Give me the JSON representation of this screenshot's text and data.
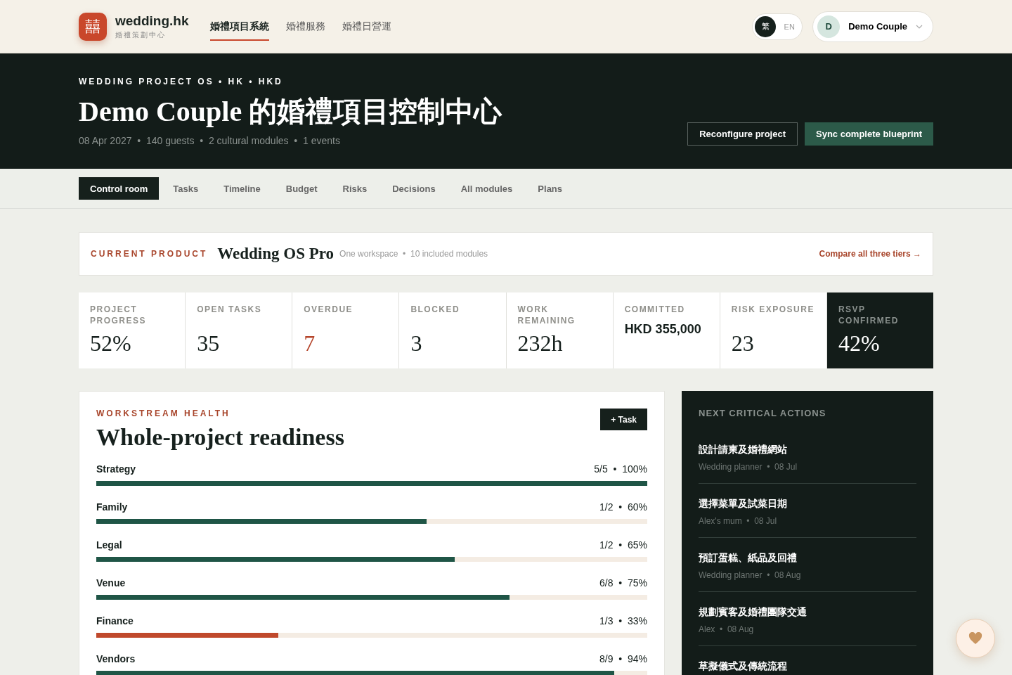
{
  "brand": {
    "logo": "囍",
    "name": "wedding.hk",
    "tagline": "婚禮策劃中心"
  },
  "nav": [
    {
      "label": "婚禮項目系統",
      "selected": true
    },
    {
      "label": "婚禮服務",
      "selected": false
    },
    {
      "label": "婚禮日營運",
      "selected": false
    }
  ],
  "language": [
    {
      "label": "繁",
      "selected": true
    },
    {
      "label": "EN",
      "selected": false
    }
  ],
  "user": {
    "initial": "D",
    "name": "Demo Couple"
  },
  "hero": {
    "eyebrow": "WEDDING PROJECT OS • HK • HKD",
    "title": "Demo Couple 的婚禮項目控制中心",
    "meta": "08 Apr 2027  •  140 guests  •  2 cultural modules  •  1 events",
    "buttons": [
      {
        "label": "Reconfigure project",
        "kind": "outline"
      },
      {
        "label": "Sync complete blueprint",
        "kind": "primary"
      }
    ]
  },
  "tabs": [
    {
      "label": "Control room",
      "selected": true
    },
    {
      "label": "Tasks",
      "selected": false
    },
    {
      "label": "Timeline",
      "selected": false
    },
    {
      "label": "Budget",
      "selected": false
    },
    {
      "label": "Risks",
      "selected": false
    },
    {
      "label": "Decisions",
      "selected": false
    },
    {
      "label": "All modules",
      "selected": false
    },
    {
      "label": "Plans",
      "selected": false
    }
  ],
  "product": {
    "label": "CURRENT PRODUCT",
    "name": "Wedding OS Pro",
    "detail": "One workspace  •  10 included modules",
    "link": "Compare all three tiers →"
  },
  "stats": [
    {
      "label": "PROJECT PROGRESS",
      "value": "52%",
      "kind": "plain"
    },
    {
      "label": "OPEN TASKS",
      "value": "35",
      "kind": "plain"
    },
    {
      "label": "OVERDUE",
      "value": "7",
      "kind": "alert"
    },
    {
      "label": "BLOCKED",
      "value": "3",
      "kind": "plain"
    },
    {
      "label": "WORK REMAINING",
      "value": "232h",
      "kind": "plain"
    },
    {
      "label": "COMMITTED",
      "value": "HKD 355,000",
      "kind": "amount"
    },
    {
      "label": "RISK EXPOSURE",
      "value": "23",
      "kind": "plain"
    },
    {
      "label": "RSVP CONFIRMED",
      "value": "42%",
      "kind": "dark"
    }
  ],
  "workstream": {
    "eyebrow": "WORKSTREAM HEALTH",
    "title": "Whole-project readiness",
    "button": "+ Task",
    "rows": [
      {
        "name": "Strategy",
        "reading": "5/5  •  100%",
        "level": 1.0,
        "color": "#1f5546"
      },
      {
        "name": "Family",
        "reading": "1/2  •  60%",
        "level": 0.6,
        "color": "#1f5546"
      },
      {
        "name": "Legal",
        "reading": "1/2  •  65%",
        "level": 0.65,
        "color": "#1f5546"
      },
      {
        "name": "Venue",
        "reading": "6/8  •  75%",
        "level": 0.75,
        "color": "#1f5546"
      },
      {
        "name": "Finance",
        "reading": "1/3  •  33%",
        "level": 0.33,
        "color": "#c0492c"
      },
      {
        "name": "Vendors",
        "reading": "8/9  •  94%",
        "level": 0.94,
        "color": "#1f5546"
      }
    ]
  },
  "actions": {
    "title": "NEXT CRITICAL ACTIONS",
    "items": [
      {
        "title": "設計請柬及婚禮網站",
        "meta": "Wedding planner  •  08 Jul"
      },
      {
        "title": "選擇菜單及試菜日期",
        "meta": "Alex's mum  •  08 Jul"
      },
      {
        "title": "預訂蛋糕、紙品及回禮",
        "meta": "Wedding planner  •  08 Aug"
      },
      {
        "title": "規劃賓客及婚禮團隊交通",
        "meta": "Alex  •  08 Aug"
      },
      {
        "title": "草擬儀式及傳統流程"
      }
    ]
  }
}
